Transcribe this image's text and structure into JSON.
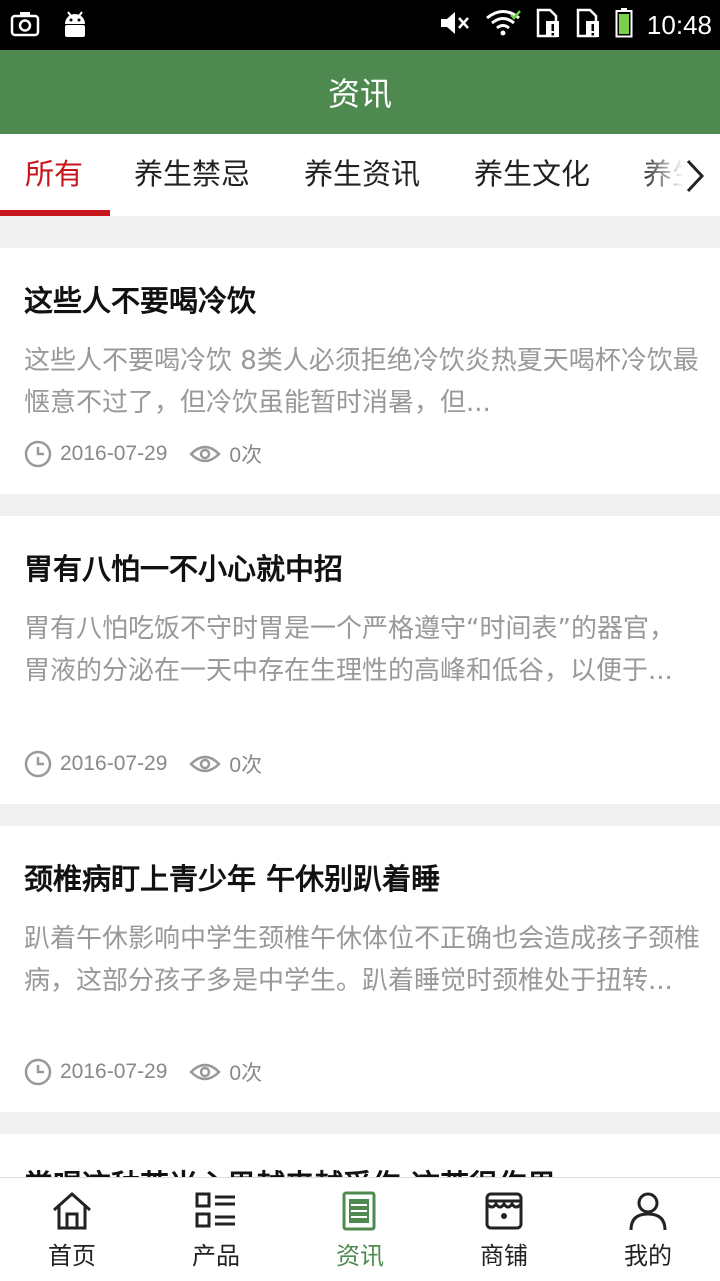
{
  "status_bar": {
    "time": "10:48"
  },
  "header": {
    "title": "资讯"
  },
  "tabs": [
    "所有",
    "养生禁忌",
    "养生资讯",
    "养生文化",
    "养生"
  ],
  "articles": [
    {
      "title": "这些人不要喝冷饮",
      "summary": "这些人不要喝冷饮  8类人必须拒绝冷饮炎热夏天喝杯冷饮最惬意不过了，但冷饮虽能暂时消暑，但...",
      "date": "2016-07-29",
      "views": "0次"
    },
    {
      "title": "胃有八怕一不小心就中招",
      "summary": "胃有八怕吃饭不守时胃是一个严格遵守“时间表”的器官，胃液的分泌在一天中存在生理性的高峰和低谷，以便于...",
      "date": "2016-07-29",
      "views": "0次"
    },
    {
      "title": "颈椎病盯上青少年 午休别趴着睡",
      "summary": "趴着午休影响中学生颈椎午休体位不正确也会造成孩子颈椎病，这部分孩子多是中学生。趴着睡觉时颈椎处于扭转...",
      "date": "2016-07-29",
      "views": "0次"
    },
    {
      "title": "常喝这种茶当心男越来越受伤 这茶很伤男"
    }
  ],
  "bottom_nav": [
    "首页",
    "产品",
    "资讯",
    "商铺",
    "我的"
  ],
  "colors": {
    "header": "#4e8a50",
    "tab_active": "#c8161d",
    "nav_active": "#4e8a50"
  }
}
